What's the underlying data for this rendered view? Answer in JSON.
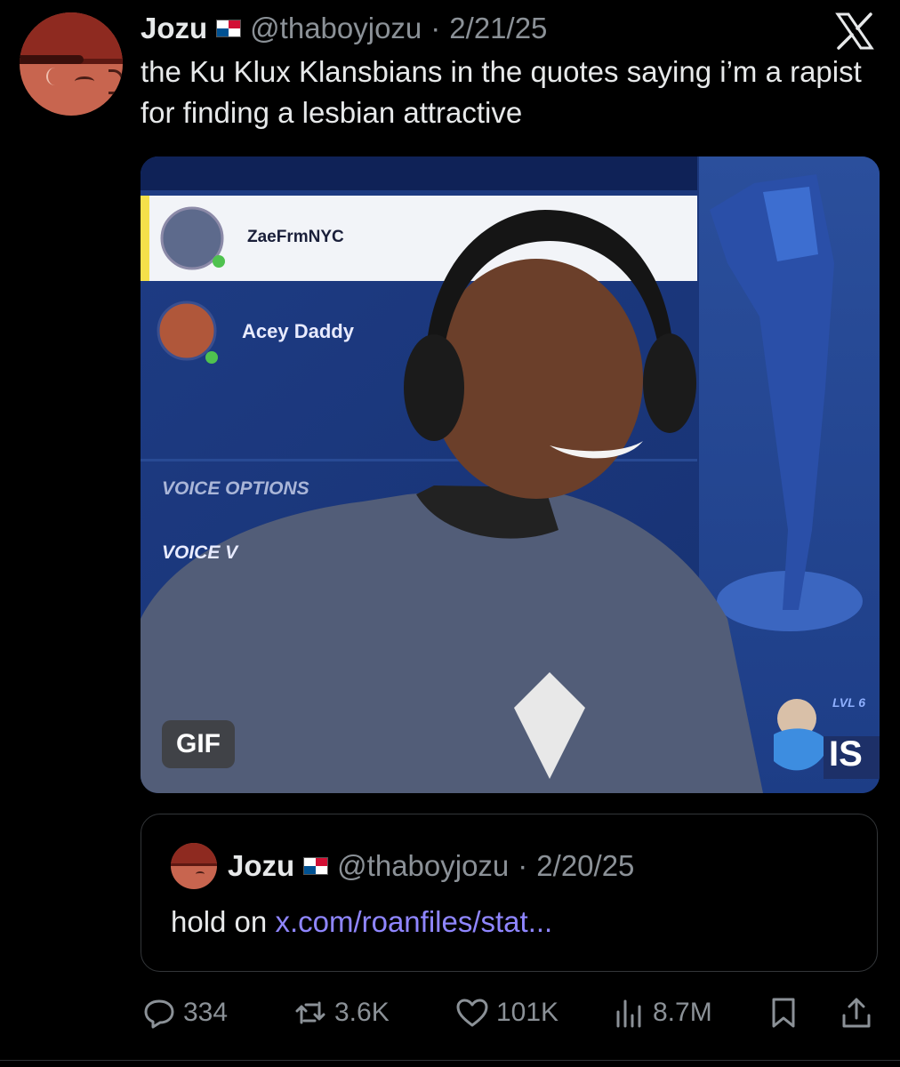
{
  "tweet": {
    "display_name": "Jozu",
    "handle": "@thaboyjozu",
    "date_separator": "·",
    "date": "2/21/25",
    "flag_icon": "panama-flag-icon",
    "text": "the Ku Klux Klansbians in the quotes saying i’m a rapist for finding a lesbian attractive"
  },
  "media": {
    "badge": "GIF",
    "overlay": {
      "friend_1": "ZaeFrmNYC",
      "friend_2": "Acey Daddy",
      "voice_options": "VOICE OPTIONS",
      "voice_partial": "VOICE V",
      "level_label": "LVL 6",
      "tag_partial": "IS"
    }
  },
  "quote": {
    "display_name": "Jozu",
    "handle": "@thaboyjozu",
    "date_separator": "·",
    "date": "2/20/25",
    "text_prefix": "hold on",
    "link": "x.com/roanfiles/stat..."
  },
  "actions": {
    "replies": "334",
    "reposts": "3.6K",
    "likes": "101K",
    "views": "8.7M"
  },
  "colors": {
    "background": "#000000",
    "text": "#e7e9ea",
    "muted": "#8b9197",
    "link": "#8f86ff",
    "border": "#333639"
  }
}
